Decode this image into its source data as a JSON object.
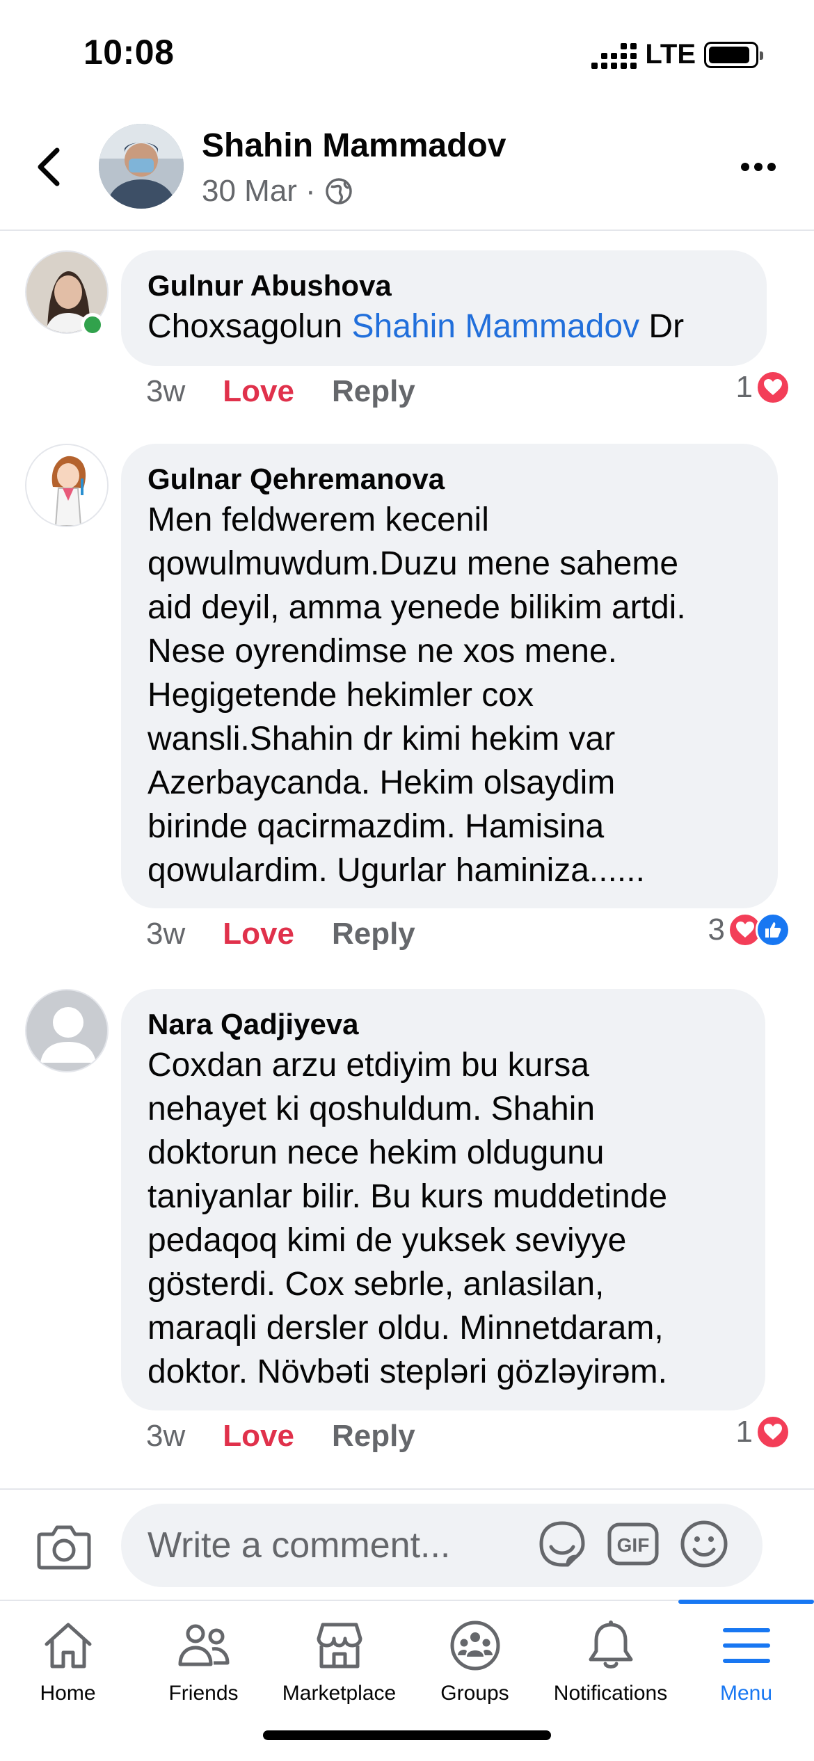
{
  "status_bar": {
    "time": "10:08",
    "network": "LTE"
  },
  "post_header": {
    "author": "Shahin Mammadov",
    "date": "30 Mar",
    "separator": "·",
    "audience_icon": "globe-icon"
  },
  "comments": [
    {
      "author": "Gulnur Abushova",
      "text_before": "Choxsagolun ",
      "mention": "Shahin Mammadov",
      "text_after": " Dr",
      "time": "3w",
      "love_label": "Love",
      "reply_label": "Reply",
      "reaction_count": "1",
      "online": true
    },
    {
      "author": "Gulnar Qehremanova",
      "text": "Men feldwerem kecenil\nqowulmuwdum.Duzu  mene saheme\naid deyil, amma yenede bilikim artdi.\nNese oyrendimse ne xos mene.\nHegigetende hekimler cox\nwansli.Shahin dr kimi hekim var\nAzerbaycanda. Hekim olsaydim\nbirinde qacirmazdim. Hamisina\nqowulardim. Ugurlar haminiza......",
      "time": "3w",
      "love_label": "Love",
      "reply_label": "Reply",
      "reaction_count": "3"
    },
    {
      "author": "Nara Qadjiyeva",
      "text": "Coxdan arzu etdiyim bu kursa\nnehayet ki qoshuldum. Shahin\ndoktorun nece hekim oldugunu\ntaniyanlar bilir. Bu kurs muddetinde\npedaqoq kimi de yuksek seviyye\ngösterdi. Cox sebrle, anlasilan,\nmaraqli dersler oldu. Minnetdaram,\ndoktor. Növbəti stepləri gözləyirəm.",
      "time": "3w",
      "love_label": "Love",
      "reply_label": "Reply",
      "reaction_count": "1"
    }
  ],
  "composer": {
    "placeholder": "Write a comment...",
    "gif_label": "GIF"
  },
  "bottom_nav": {
    "items": [
      {
        "label": "Home",
        "icon": "home-icon"
      },
      {
        "label": "Friends",
        "icon": "friends-icon"
      },
      {
        "label": "Marketplace",
        "icon": "marketplace-icon"
      },
      {
        "label": "Groups",
        "icon": "groups-icon"
      },
      {
        "label": "Notifications",
        "icon": "bell-icon"
      },
      {
        "label": "Menu",
        "icon": "menu-icon",
        "active": true
      }
    ]
  },
  "colors": {
    "accent": "#1877f2",
    "love": "#e0314b",
    "bubble": "#f0f2f5",
    "mention": "#216fdb"
  }
}
